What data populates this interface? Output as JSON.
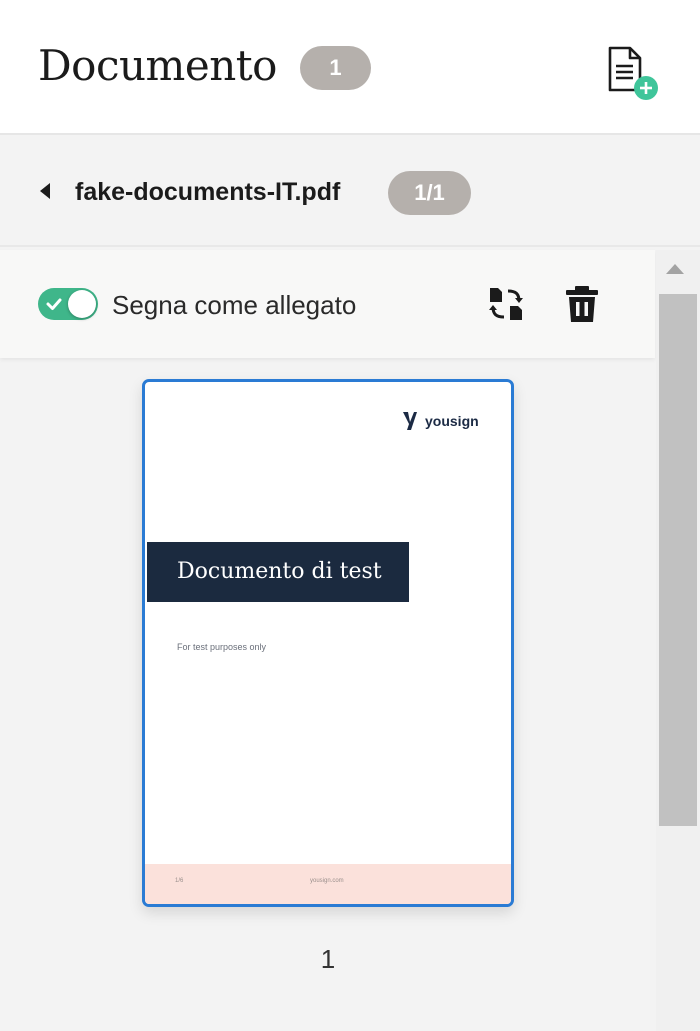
{
  "header": {
    "title": "Documento",
    "count": "1"
  },
  "file": {
    "name": "fake-documents-IT.pdf",
    "pages": "1/1"
  },
  "toolbar": {
    "attachment_label": "Segna come allegato",
    "attachment_enabled": true
  },
  "thumbnail": {
    "logo_text": "yousign",
    "banner_title": "Documento di test",
    "subtitle": "For test purposes only",
    "footer_left": "1/6",
    "footer_center": "yousign.com"
  },
  "page_number": "1",
  "colors": {
    "accent_green": "#3fb68a",
    "badge_gray": "#b5b0ac",
    "selected_blue": "#2a7bd4",
    "banner_navy": "#1b2a3f",
    "footer_pink": "#fbe1db"
  },
  "icons": {
    "add_document": "document-add-icon",
    "collapse": "caret-left-icon",
    "replace": "swap-document-icon",
    "delete": "trash-icon",
    "toggle_check": "check-icon"
  }
}
